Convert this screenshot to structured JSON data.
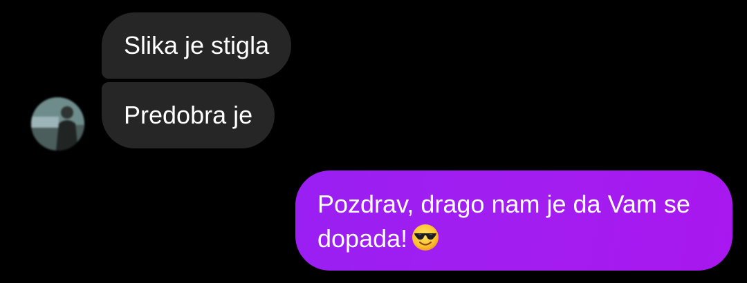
{
  "thread": {
    "messages": [
      {
        "direction": "incoming",
        "text": "Slika je stigla"
      },
      {
        "direction": "incoming",
        "text": "Predobra je"
      },
      {
        "direction": "outgoing",
        "line1": "Pozdrav, drago nam je da Vam se",
        "line2": "dopada!",
        "emoji": "smiling-face-with-sunglasses"
      }
    ],
    "colors": {
      "background": "#000000",
      "incoming_bubble": "#262626",
      "outgoing_bubble": "#a21ef0",
      "text": "#ffffff"
    }
  }
}
